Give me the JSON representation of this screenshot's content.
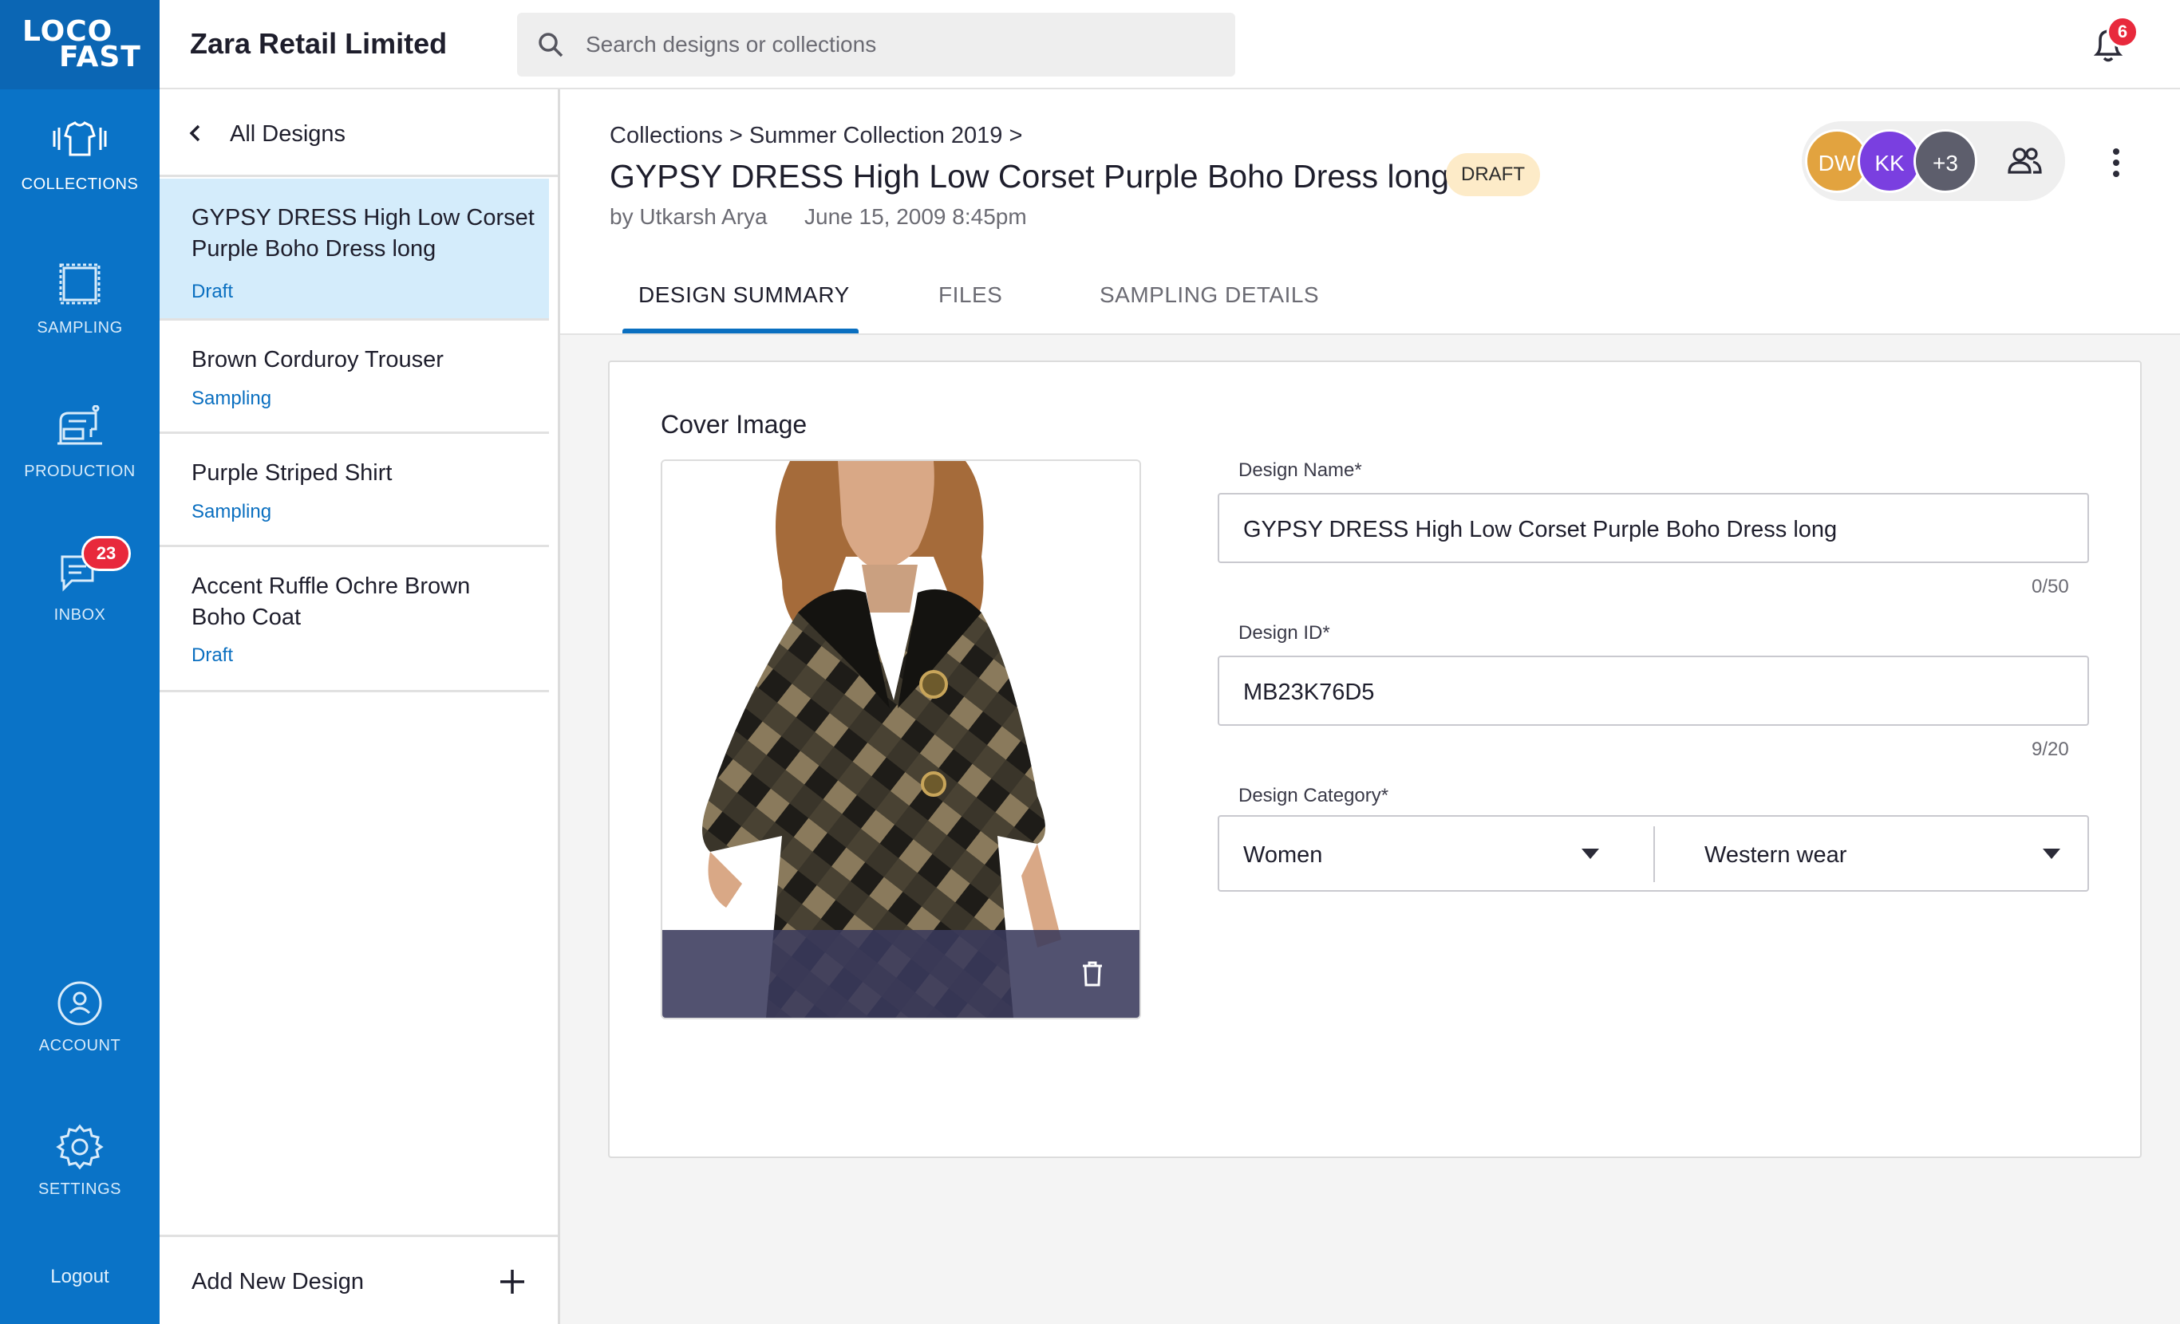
{
  "brand": {
    "line1": "LOCO",
    "line2": "FAST"
  },
  "nav": {
    "items": [
      {
        "label": "COLLECTIONS",
        "icon": "tshirt-rack-icon",
        "active": true
      },
      {
        "label": "SAMPLING",
        "icon": "fabric-swatch-icon"
      },
      {
        "label": "PRODUCTION",
        "icon": "sewing-machine-icon"
      },
      {
        "label": "INBOX",
        "icon": "chat-icon",
        "badge": "23"
      },
      {
        "label": "ACCOUNT",
        "icon": "user-circle-icon"
      },
      {
        "label": "SETTINGS",
        "icon": "gear-icon"
      }
    ],
    "logout": "Logout"
  },
  "header": {
    "company": "Zara Retail Limited",
    "search_placeholder": "Search designs or collections",
    "notification_count": "6"
  },
  "list": {
    "back_label": "All Designs",
    "items": [
      {
        "name": "GYPSY DRESS High Low Corset Purple Boho Dress long",
        "status": "Draft",
        "active": true
      },
      {
        "name": "Brown Corduroy Trouser",
        "status": "Sampling"
      },
      {
        "name": "Purple Striped Shirt",
        "status": "Sampling"
      },
      {
        "name": "Accent Ruffle Ochre Brown Boho Coat",
        "status": "Draft"
      }
    ],
    "add_label": "Add New Design"
  },
  "design": {
    "breadcrumb": "Collections > Summer Collection 2019 >",
    "title": "GYPSY DRESS High Low Corset Purple Boho Dress long",
    "badge": "DRAFT",
    "author": "by Utkarsh Arya",
    "date": "June 15, 2009 8:45pm",
    "collaborators": [
      {
        "initials": "DW",
        "color": "#e2a33f"
      },
      {
        "initials": "KK",
        "color": "#7a3fe0"
      },
      {
        "initials": "+3",
        "color": "#5d5e6c"
      }
    ]
  },
  "tabs": [
    {
      "label": "DESIGN SUMMARY",
      "active": true
    },
    {
      "label": "FILES"
    },
    {
      "label": "SAMPLING DETAILS"
    }
  ],
  "summary": {
    "cover_title": "Cover Image",
    "fields": {
      "name_label": "Design Name*",
      "name_value": "GYPSY DRESS High Low Corset Purple Boho Dress long",
      "name_count": "0/50",
      "id_label": "Design ID*",
      "id_value": "MB23K76D5",
      "id_count": "9/20",
      "category_label": "Design Category*",
      "category_value": "Women",
      "subcategory_value": "Western wear"
    }
  },
  "colors": {
    "rail": "#0a73c7",
    "accent": "#0a6fc0",
    "active_item": "#d4ecfb",
    "draft_badge": "#fdebc8",
    "alert": "#e8293c"
  }
}
